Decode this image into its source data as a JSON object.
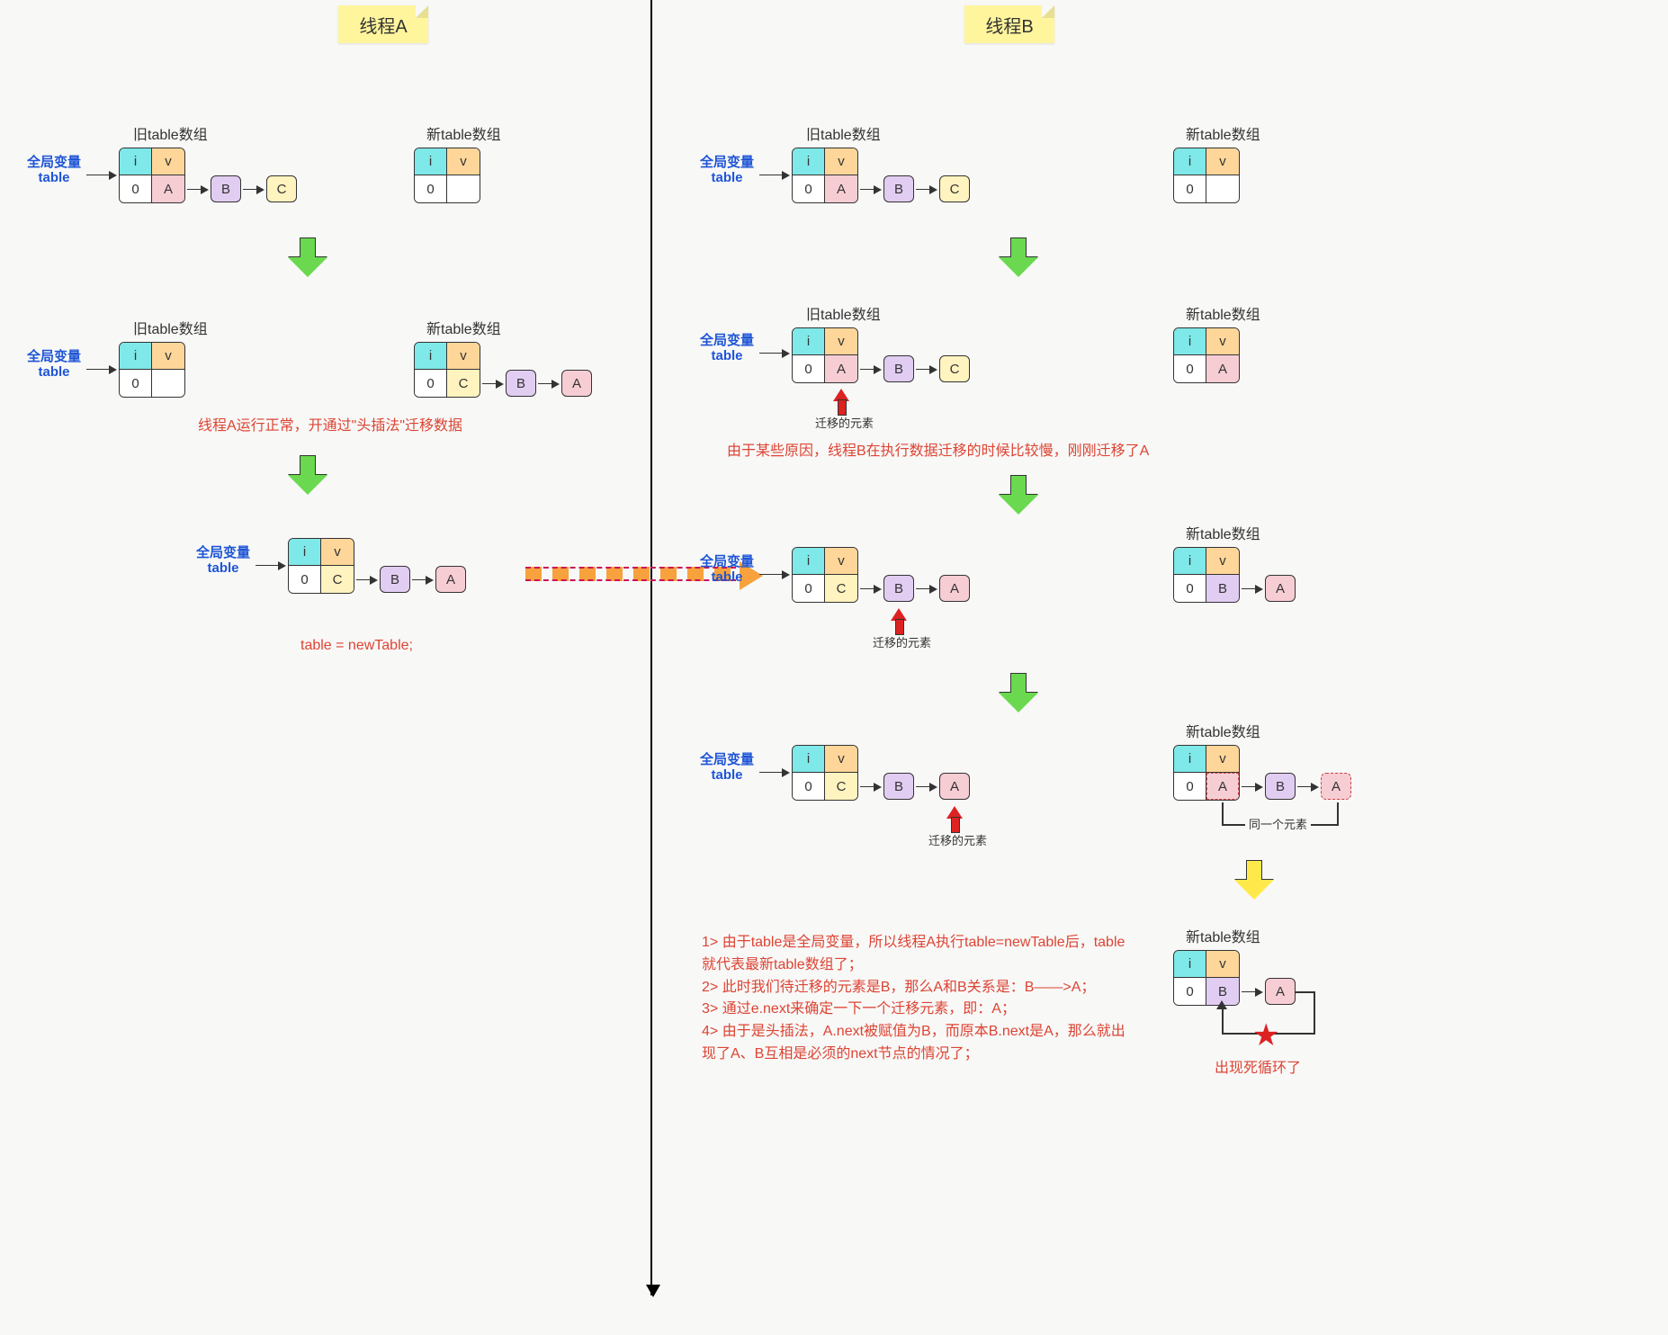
{
  "titles": {
    "threadA": "线程A",
    "threadB": "线程B"
  },
  "labels": {
    "globalVar": "全局变量\ntable",
    "oldTable": "旧table数组",
    "newTable": "新table数组",
    "migrateElem": "迁移的元素",
    "sameElem": "同一个元素",
    "deadLoop": "出现死循环了"
  },
  "cells": {
    "i": "i",
    "v": "v",
    "zero": "0",
    "A": "A",
    "B": "B",
    "C": "C"
  },
  "textA_step2": "线程A运行正常，开通过\"头插法\"迁移数据",
  "textA_step3": "table = newTable;",
  "textB_step2": "由于某些原因，线程B在执行数据迁移的时候比较慢，刚刚迁移了A",
  "textB_final": "1> 由于table是全局变量，所以线程A执行table=newTable后，table就代表最新table数组了；\n2> 此时我们待迁移的元素是B，那么A和B关系是：B——>A；\n3> 通过e.next来确定一下一个迁移元素，即：A；\n4> 由于是头插法，A.next被赋值为B，而原本B.next是A，那么就出现了A、B互相是必须的next节点的情况了；",
  "chart_data": {
    "type": "table",
    "description": "HashMap resize death-loop illustration with two threads using head-insertion",
    "threadA": {
      "steps": [
        {
          "oldTable": {
            "bucket0": [
              "A",
              "B",
              "C"
            ]
          },
          "newTable": {
            "bucket0": []
          }
        },
        {
          "oldTable": {
            "bucket0": []
          },
          "newTable": {
            "bucket0": [
              "C",
              "B",
              "A"
            ]
          },
          "note": "线程A运行正常，开通过\"头插法\"迁移数据"
        },
        {
          "assign": "table = newTable;",
          "newTable": {
            "bucket0": [
              "C",
              "B",
              "A"
            ]
          }
        }
      ]
    },
    "threadB": {
      "steps": [
        {
          "oldTable": {
            "bucket0": [
              "A",
              "B",
              "C"
            ]
          },
          "newTable": {
            "bucket0": []
          }
        },
        {
          "oldTable": {
            "bucket0": [
              "A",
              "B",
              "C"
            ]
          },
          "migrating": "A",
          "newTable": {
            "bucket0": [
              "A"
            ]
          },
          "note": "由于某些原因，线程B在执行数据迁移的时候比较慢，刚刚迁移了A"
        },
        {
          "globalTable": {
            "bucket0": [
              "C",
              "B",
              "A"
            ]
          },
          "migrating": "B",
          "newTable": {
            "bucket0": [
              "B",
              "A"
            ]
          }
        },
        {
          "globalTable": {
            "bucket0": [
              "C",
              "B",
              "A"
            ]
          },
          "migrating": "A",
          "newTable": {
            "bucket0_cycle": [
              "A",
              "B",
              "A"
            ],
            "sameElement": true
          }
        },
        {
          "newTable": {
            "bucket0_cycle": [
              "B",
              "A",
              "B"
            ]
          },
          "result": "出现死循环了"
        }
      ]
    }
  }
}
